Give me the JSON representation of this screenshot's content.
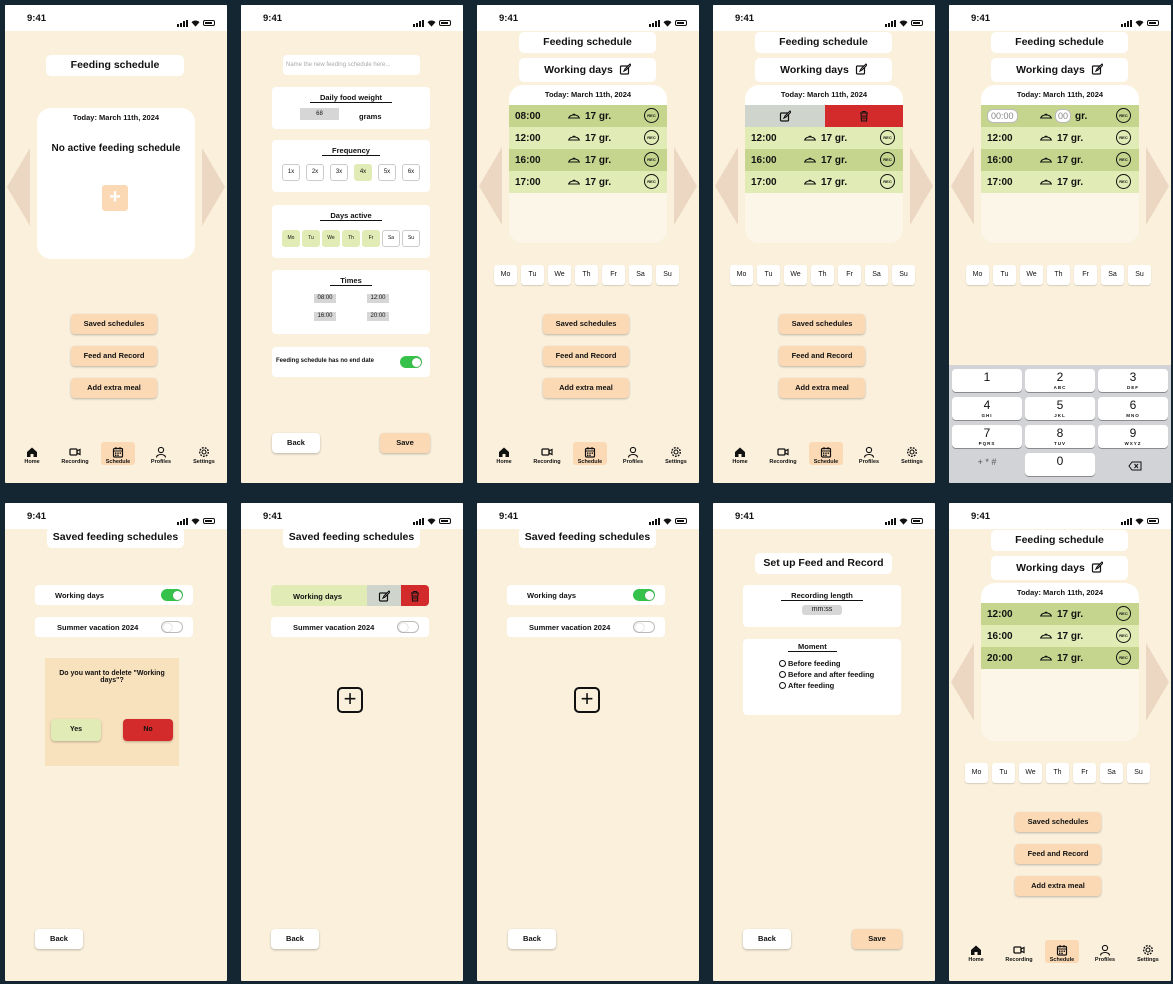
{
  "status_time": "9:41",
  "colors": {
    "bg": "#faf0dc",
    "accent": "#fbd9b4",
    "green_dark": "#c6d58e",
    "green_light": "#e1ebb5",
    "delete_red": "#d32b2b",
    "toggle_on": "#36c24a",
    "frame": "#132631"
  },
  "nav": [
    "Home",
    "Recording",
    "Schedule",
    "Profiles",
    "Settings"
  ],
  "icons": {
    "home": "home-icon",
    "recording": "video-icon",
    "schedule": "calendar-icon",
    "profiles": "user-icon",
    "settings": "gear-icon",
    "edit": "edit-icon",
    "trash": "trash-icon",
    "bowl": "food-bowl-icon",
    "rec": "rec-icon",
    "plus": "plus-icon",
    "backspace": "backspace-icon"
  },
  "day_letters": [
    "Mo",
    "Tu",
    "We",
    "Th",
    "Fr",
    "Sa",
    "Su"
  ],
  "buttons": {
    "saved": "Saved schedules",
    "feed_record": "Feed and Record",
    "extra": "Add extra meal",
    "back": "Back",
    "save": "Save",
    "yes": "Yes",
    "no": "No"
  },
  "s1": {
    "title": "Feeding schedule",
    "date": "Today: March 11th, 2024",
    "empty": "No active feeding schedule",
    "plus": "+"
  },
  "s2": {
    "name_placeholder": "Name the new feeding schedule here...",
    "weight_title": "Daily food weight",
    "weight_value": "68",
    "weight_unit": "grams",
    "freq_title": "Frequency",
    "freq": [
      "1x",
      "2x",
      "3x",
      "4x",
      "5x",
      "6x"
    ],
    "freq_selected": "4x",
    "days_title": "Days active",
    "days": [
      "Mo",
      "Tu",
      "We",
      "Th",
      "Fr",
      "Sa",
      "Su"
    ],
    "days_on": [
      "Mo",
      "Tu",
      "We",
      "Th",
      "Fr"
    ],
    "times_title": "Times",
    "times": [
      "08:00",
      "12:00",
      "16:00",
      "20:00"
    ],
    "no_end": "Feeding schedule has no end date",
    "no_end_on": true
  },
  "sched": {
    "title": "Feeding schedule",
    "name": "Working days",
    "date": "Today: March 11th, 2024",
    "rec": "REC",
    "rows": [
      {
        "time": "08:00",
        "amount": "17 gr."
      },
      {
        "time": "12:00",
        "amount": "17 gr."
      },
      {
        "time": "16:00",
        "amount": "17 gr."
      },
      {
        "time": "17:00",
        "amount": "17 gr."
      }
    ]
  },
  "s5": {
    "time_placeholder": "00:00",
    "amount_placeholder": "00",
    "unit": "gr.",
    "keys": [
      {
        "n": "1",
        "l": ""
      },
      {
        "n": "2",
        "l": "ABC"
      },
      {
        "n": "3",
        "l": "DEF"
      },
      {
        "n": "4",
        "l": "GHI"
      },
      {
        "n": "5",
        "l": "JKL"
      },
      {
        "n": "6",
        "l": "MNO"
      },
      {
        "n": "7",
        "l": "PQRS"
      },
      {
        "n": "8",
        "l": "TUV"
      },
      {
        "n": "9",
        "l": "WXYZ"
      },
      {
        "n": "+ * #",
        "l": ""
      },
      {
        "n": "0",
        "l": ""
      }
    ]
  },
  "saved": {
    "title": "Saved feeding schedules",
    "items": [
      {
        "name": "Working days",
        "on": true
      },
      {
        "name": "Summer vacation 2024",
        "on": false
      }
    ],
    "confirm": "Do you want to delete \"Working days\"?"
  },
  "s9": {
    "title": "Set up Feed and Record",
    "len_title": "Recording length",
    "len_placeholder": "mm:ss",
    "moment_title": "Moment",
    "options": [
      "Before feeding",
      "Before and after feeding",
      "After feeding"
    ]
  },
  "s10": {
    "rows": [
      {
        "time": "12:00",
        "amount": "17 gr."
      },
      {
        "time": "16:00",
        "amount": "17 gr."
      },
      {
        "time": "20:00",
        "amount": "17 gr."
      }
    ]
  }
}
